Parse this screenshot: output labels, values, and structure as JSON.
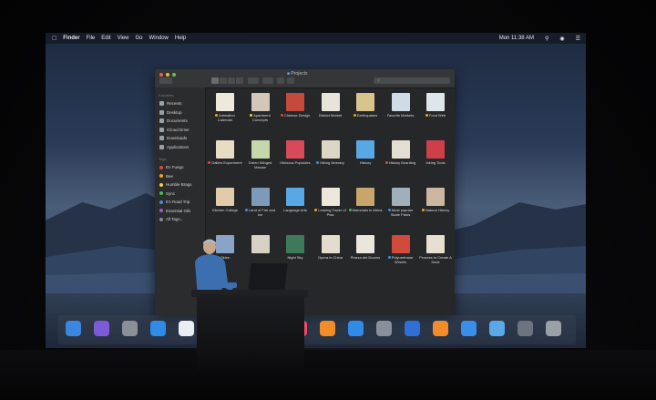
{
  "menubar": {
    "app_name": "Finder",
    "menus": [
      "File",
      "Edit",
      "View",
      "Go",
      "Window",
      "Help"
    ],
    "clock": "Mon 11:38 AM"
  },
  "window": {
    "title": "Projects",
    "search_placeholder": ""
  },
  "sidebar": {
    "favorites_heading": "Favorites",
    "favorites": [
      "Recents",
      "Desktop",
      "Documents",
      "iCloud Drive",
      "Downloads",
      "Applications"
    ],
    "tags_heading": "Tags",
    "tags": [
      {
        "label": "En Fuego",
        "color": "#e0453a"
      },
      {
        "label": "Bee",
        "color": "#f0a322"
      },
      {
        "label": "Humble Brags",
        "color": "#f4d03a"
      },
      {
        "label": "Sync",
        "color": "#3cc050"
      },
      {
        "label": "It's Road Trip",
        "color": "#3a8ee8"
      },
      {
        "label": "Essential Oils",
        "color": "#a05ad8"
      },
      {
        "label": "All Tags...",
        "color": "#8a8a8e"
      }
    ]
  },
  "files": [
    {
      "name": "Animation Calendar",
      "tag": "#f0a322",
      "thumb": "#efe9dc"
    },
    {
      "name": "Apartment Concepts",
      "tag": "#f4d03a",
      "thumb": "#d4c7b8"
    },
    {
      "name": "Chinese Design",
      "tag": "#e0453a",
      "thumb": "#c44a3e"
    },
    {
      "name": "District Market",
      "tag": "",
      "thumb": "#e9e4da"
    },
    {
      "name": "Earthquakes",
      "tag": "#f0a322",
      "thumb": "#d9c48e"
    },
    {
      "name": "Favorite Markets",
      "tag": "",
      "thumb": "#cfdbe6"
    },
    {
      "name": "Food Web",
      "tag": "#f0a322",
      "thumb": "#dfe6ea"
    },
    {
      "name": "Daliles Experiment",
      "tag": "#e0453a",
      "thumb": "#e7dcc4"
    },
    {
      "name": "Green Winged Macaw",
      "tag": "",
      "thumb": "#c7d7ad"
    },
    {
      "name": "Hibiscus Popsicles",
      "tag": "",
      "thumb": "#d64a5a"
    },
    {
      "name": "Hiking Itinerary",
      "tag": "#3a8ee8",
      "thumb": "#dcd6c6"
    },
    {
      "name": "History",
      "tag": "",
      "thumb": "#59a8e6"
    },
    {
      "name": "History Boarding",
      "tag": "#e0453a",
      "thumb": "#e3ded1"
    },
    {
      "name": "Inking Tools",
      "tag": "",
      "thumb": "#cf3f48"
    },
    {
      "name": "Kitchen College",
      "tag": "",
      "thumb": "#e2cba8"
    },
    {
      "name": "Land of Fire and Ice",
      "tag": "#3a8ee8",
      "thumb": "#7d9bb8"
    },
    {
      "name": "Language Arts",
      "tag": "",
      "thumb": "#59a8e6"
    },
    {
      "name": "Leaning Tower of Pisa",
      "tag": "#f0a322",
      "thumb": "#ece7db"
    },
    {
      "name": "Mammals in Africa",
      "tag": "#3cc050",
      "thumb": "#c8a56a"
    },
    {
      "name": "Most popular Skate Parks",
      "tag": "#3a8ee8",
      "thumb": "#9fb0bb"
    },
    {
      "name": "Natural History",
      "tag": "#f0a322",
      "thumb": "#cbb6a0"
    },
    {
      "name": "Skies",
      "tag": "",
      "thumb": "#8aa3c9"
    },
    {
      "name": "",
      "tag": "",
      "thumb": "#d8d2c4"
    },
    {
      "name": "Night Sky",
      "tag": "",
      "thumb": "#3e7a5a"
    },
    {
      "name": "Opera in China",
      "tag": "",
      "thumb": "#e4dccd"
    },
    {
      "name": "Piazza del Duomo",
      "tag": "",
      "thumb": "#ebe6dc"
    },
    {
      "name": "Polyurethane Wheels",
      "tag": "#3a8ee8",
      "thumb": "#d24a3c"
    },
    {
      "name": "Process to Create A Deck",
      "tag": "",
      "thumb": "#e8dfd0"
    }
  ],
  "dock": [
    {
      "name": "finder-icon",
      "color": "#3a86e0"
    },
    {
      "name": "siri-icon",
      "color": "#7a5cd8"
    },
    {
      "name": "launchpad-icon",
      "color": "#8a8f98"
    },
    {
      "name": "safari-icon",
      "color": "#2f8be6"
    },
    {
      "name": "photos-icon",
      "color": "#e9eef2"
    },
    {
      "name": "contacts-icon",
      "color": "#b48a5a"
    },
    {
      "name": "calendar-icon",
      "color": "#f2f2f2"
    },
    {
      "name": "messages-icon",
      "color": "#46c062"
    },
    {
      "name": "music-icon",
      "color": "#f24b6a"
    },
    {
      "name": "books-icon",
      "color": "#f08c2a"
    },
    {
      "name": "app-store-icon",
      "color": "#2f8be6"
    },
    {
      "name": "system-preferences-icon",
      "color": "#8a8f98"
    },
    {
      "name": "keynote-icon",
      "color": "#2f6fd6"
    },
    {
      "name": "pages-icon",
      "color": "#f08c2a"
    },
    {
      "name": "xcode-icon",
      "color": "#3a8ee8"
    },
    {
      "name": "folder-icon",
      "color": "#5aa8e8"
    },
    {
      "name": "downloads-stack-icon",
      "color": "#6c7480"
    },
    {
      "name": "trash-icon",
      "color": "#9aa0a8"
    }
  ]
}
